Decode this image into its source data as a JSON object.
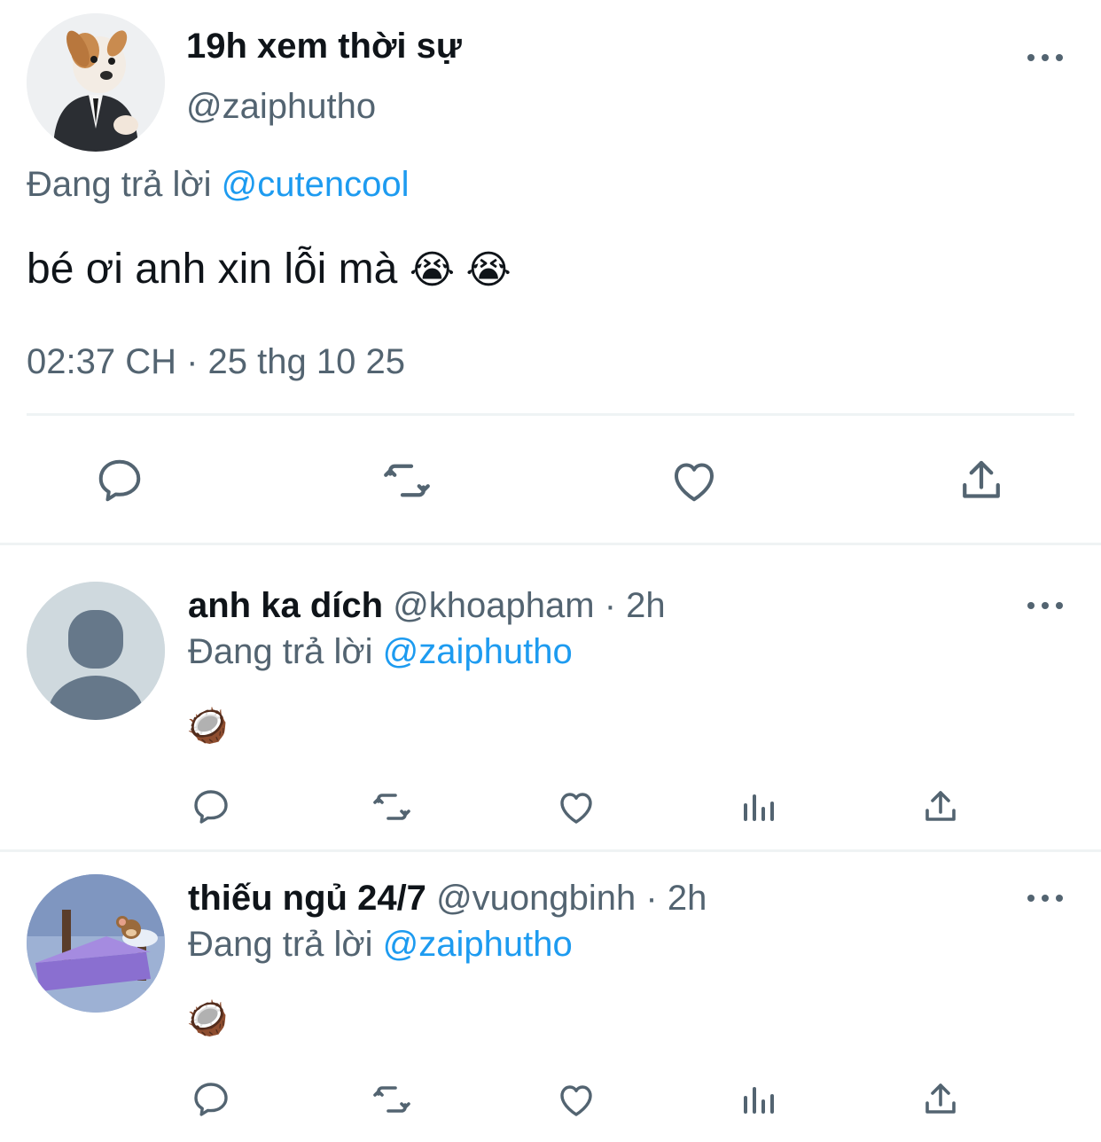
{
  "main_tweet": {
    "display_name": "19h xem thời sự",
    "handle": "@zaiphutho",
    "replying_label": "Đang trả lời",
    "replying_to": "@cutencool",
    "text": "bé ơi anh xin lỗi mà",
    "emoji": "😭 😭",
    "timestamp": "02:37 CH · 25 thg 10 25",
    "avatar_icon": "dog-in-suit-avatar",
    "actions": [
      "reply-icon",
      "retweet-icon",
      "like-icon",
      "share-icon"
    ]
  },
  "replies": [
    {
      "display_name": "anh ka dích",
      "meta": "@khoapham · 2h",
      "replying_label": "Đang trả lời",
      "replying_to": "@zaiphutho",
      "emoji": "🥥",
      "avatar_icon": "default-avatar",
      "actions": [
        "reply-icon",
        "retweet-icon",
        "like-icon",
        "views-icon",
        "share-icon"
      ]
    },
    {
      "display_name": "thiếu ngủ 24/7",
      "meta": "@vuongbinh · 2h",
      "replying_label": "Đang trả lời",
      "replying_to": "@zaiphutho",
      "emoji": "🥥",
      "avatar_icon": "sleeping-mouse-avatar",
      "actions": [
        "reply-icon",
        "retweet-icon",
        "like-icon",
        "views-icon",
        "share-icon"
      ]
    }
  ],
  "colors": {
    "text": "#0f1419",
    "muted": "#536471",
    "link": "#1d9bf0",
    "divider": "#eff3f4"
  }
}
